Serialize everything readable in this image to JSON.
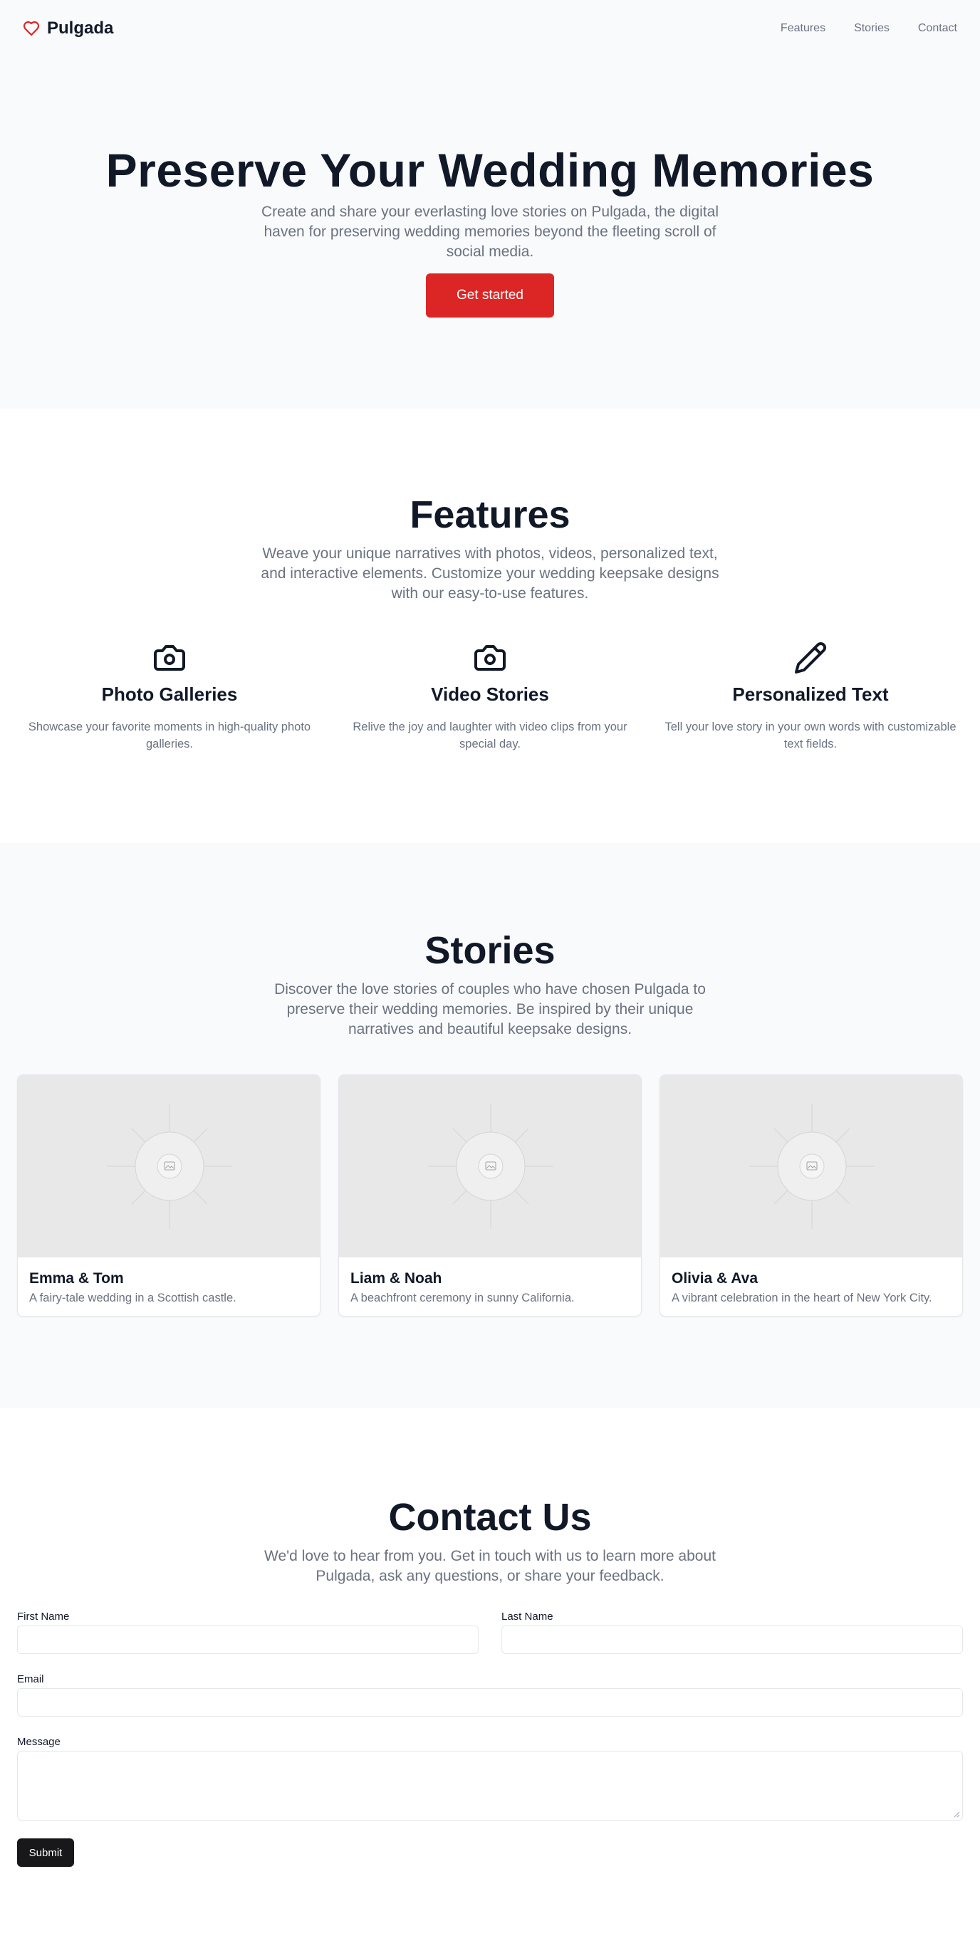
{
  "header": {
    "brand_name": "Pulgada",
    "nav": [
      "Features",
      "Stories",
      "Contact"
    ]
  },
  "hero": {
    "title": "Preserve Your Wedding Memories",
    "subtitle": "Create and share your everlasting love stories on Pulgada, the digital haven for preserving wedding memories beyond the fleeting scroll of social media.",
    "cta_label": "Get started"
  },
  "features": {
    "title": "Features",
    "subtitle": "Weave your unique narratives with photos, videos, personalized text, and interactive elements. Customize your wedding keepsake designs with our easy-to-use features.",
    "items": [
      {
        "icon": "camera-icon",
        "title": "Photo Galleries",
        "text": "Showcase your favorite moments in high-quality photo galleries."
      },
      {
        "icon": "camera-icon",
        "title": "Video Stories",
        "text": "Relive the joy and laughter with video clips from your special day."
      },
      {
        "icon": "pencil-icon",
        "title": "Personalized Text",
        "text": "Tell your love story in your own words with customizable text fields."
      }
    ]
  },
  "stories": {
    "title": "Stories",
    "subtitle": "Discover the love stories of couples who have chosen Pulgada to preserve their wedding memories. Be inspired by their unique narratives and beautiful keepsake designs.",
    "items": [
      {
        "name": "Emma & Tom",
        "text": "A fairy-tale wedding in a Scottish castle.",
        "image": "image-placeholder-icon"
      },
      {
        "name": "Liam & Noah",
        "text": "A beachfront ceremony in sunny California.",
        "image": "image-placeholder-icon"
      },
      {
        "name": "Olivia & Ava",
        "text": "A vibrant celebration in the heart of New York City.",
        "image": "image-placeholder-icon"
      }
    ]
  },
  "contact": {
    "title": "Contact Us",
    "subtitle": "We'd love to hear from you. Get in touch with us to learn more about Pulgada, ask any questions, or share your feedback.",
    "first_name_label": "First Name",
    "last_name_label": "Last Name",
    "email_label": "Email",
    "message_label": "Message",
    "submit_label": "Submit"
  },
  "colors": {
    "accent": "#dc2626",
    "heading": "#111827",
    "muted": "#6b7280",
    "section_bg": "#f9fafb",
    "submit_bg": "#18181b"
  }
}
